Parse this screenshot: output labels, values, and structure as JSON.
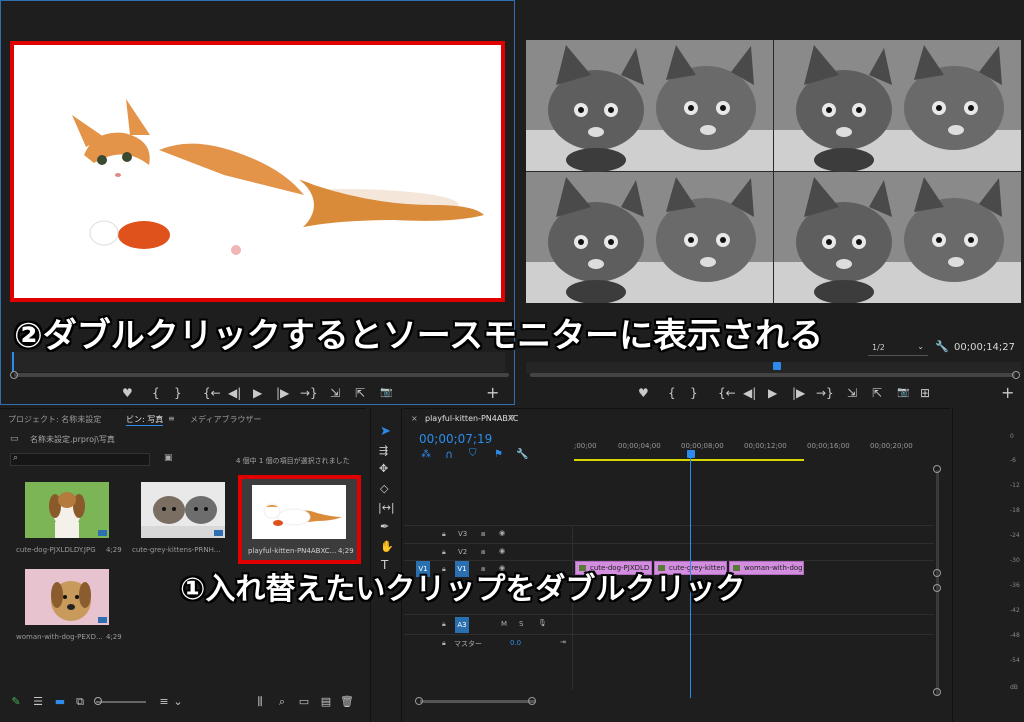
{
  "source_monitor": {
    "controls": [
      "♥",
      "{",
      "}",
      "{←",
      "◀|",
      "▶",
      "|▶",
      "→}",
      "⇲",
      "⇱",
      "📷",
      "+"
    ]
  },
  "program_monitor": {
    "zoom": "1/2",
    "timecode": "00;00;14;27",
    "controls": [
      "♥",
      "{",
      "}",
      "{←",
      "◀|",
      "▶",
      "|▶",
      "→}",
      "⇲",
      "⇱",
      "📷",
      "⊞",
      "+"
    ]
  },
  "project_panel": {
    "tabs": [
      "プロジェクト: 名称未設定",
      "ビン: 写真",
      "メディアブラウザー"
    ],
    "path": "名称未設定.prproj\\写真",
    "selection_info": "4 個中 1 個の項目が選択されました",
    "items": [
      {
        "name": "cute-dog-PJXLDLDY.JPG",
        "duration": "4;29"
      },
      {
        "name": "cute-grey-kittens-PRNH...",
        "duration": "4;29"
      },
      {
        "name": "playful-kitten-PN4ABXC...",
        "duration": "4;29"
      },
      {
        "name": "woman-with-dog-PEXD...",
        "duration": "4;29"
      }
    ]
  },
  "timeline": {
    "tab": "playful-kitten-PN4ABXC",
    "timecode": "00;00;07;19",
    "ruler": [
      ";00;00",
      "00;00;04;00",
      "00;00;08;00",
      "00;00;12;00",
      "00;00;16;00",
      "00;00;20;00"
    ],
    "tracks": {
      "v3": "V3",
      "v2": "V2",
      "v1": "V1",
      "v1src": "V1",
      "a3": "A3",
      "m": "M",
      "s": "S"
    },
    "master": "マスター",
    "master_value": "0.0",
    "clips": [
      "cute-dog-PJXDLD",
      "cute-grey-kitten",
      "woman-with-dog"
    ]
  },
  "meter": [
    "0",
    "-6",
    "-12",
    "-18",
    "-24",
    "-30",
    "-36",
    "-42",
    "-48",
    "-54",
    "dB"
  ],
  "callouts": {
    "top": "②ダブルクリックするとソースモニターに表示される",
    "bottom": "①入れ替えたいクリップをダブルクリック"
  },
  "colors": {
    "highlight": "#e00000",
    "accent": "#2d8ceb"
  }
}
